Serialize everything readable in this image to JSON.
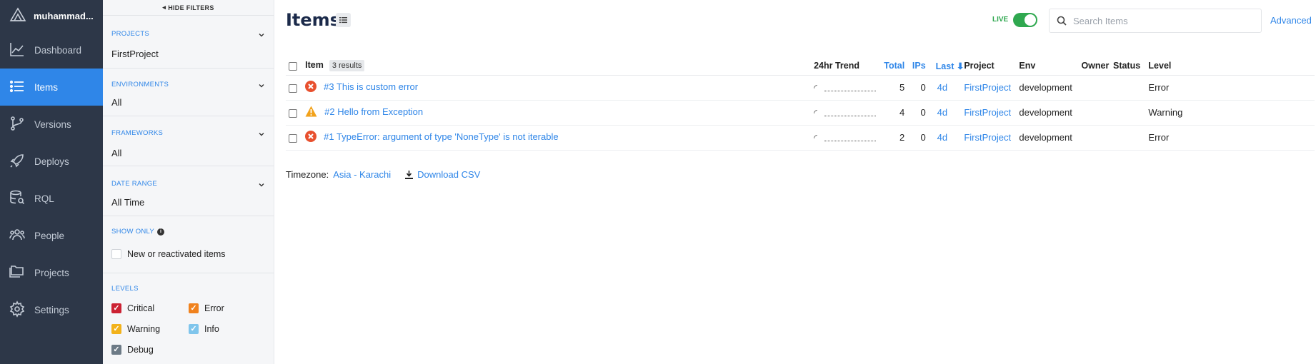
{
  "sidebar": {
    "account": "muhammad...",
    "items": [
      {
        "label": "Dashboard",
        "icon": "chart-line-icon"
      },
      {
        "label": "Items",
        "icon": "list-icon",
        "active": true
      },
      {
        "label": "Versions",
        "icon": "branch-icon"
      },
      {
        "label": "Deploys",
        "icon": "rocket-icon"
      },
      {
        "label": "RQL",
        "icon": "database-search-icon"
      },
      {
        "label": "People",
        "icon": "people-icon"
      },
      {
        "label": "Projects",
        "icon": "folder-icon"
      },
      {
        "label": "Settings",
        "icon": "gear-icon"
      }
    ]
  },
  "filters": {
    "hide_label": "HIDE FILTERS",
    "projects": {
      "label": "PROJECTS",
      "value": "FirstProject"
    },
    "environments": {
      "label": "ENVIRONMENTS",
      "value": "All"
    },
    "frameworks": {
      "label": "FRAMEWORKS",
      "value": "All"
    },
    "date_range": {
      "label": "DATE RANGE",
      "value": "All Time"
    },
    "show_only": {
      "label": "SHOW ONLY",
      "option": "New or reactivated items"
    },
    "levels": {
      "label": "LEVELS",
      "critical": "Critical",
      "error": "Error",
      "warning": "Warning",
      "info": "Info",
      "debug": "Debug"
    }
  },
  "colors": {
    "accent": "#2f86e8",
    "critical": "#cc2233",
    "error": "#f0821e",
    "warning": "#f2b21b",
    "info": "#7fc5ec",
    "debug": "#6c7a86",
    "live": "#2fa84f"
  },
  "header": {
    "title": "Items",
    "live_label": "LIVE",
    "search_placeholder": "Search Items",
    "advanced_label": "Advanced"
  },
  "table": {
    "headers": {
      "item": "Item",
      "results": "3 results",
      "trend": "24hr Trend",
      "total": "Total",
      "ips": "IPs",
      "last": "Last",
      "project": "Project",
      "env": "Env",
      "owner": "Owner",
      "status": "Status",
      "level": "Level"
    },
    "rows": [
      {
        "title": "#3 This is custom error",
        "total": "5",
        "ips": "0",
        "last": "4d",
        "project": "FirstProject",
        "env": "development",
        "level": "Error",
        "icon": "error-icon"
      },
      {
        "title": "#2 Hello from Exception",
        "total": "4",
        "ips": "0",
        "last": "4d",
        "project": "FirstProject",
        "env": "development",
        "level": "Warning",
        "icon": "warning-icon"
      },
      {
        "title": "#1 TypeError: argument of type 'NoneType' is not iterable",
        "total": "2",
        "ips": "0",
        "last": "4d",
        "project": "FirstProject",
        "env": "development",
        "level": "Error",
        "icon": "error-icon"
      }
    ]
  },
  "footer": {
    "timezone_label": "Timezone:",
    "timezone_value": "Asia - Karachi",
    "download_label": "Download CSV"
  }
}
